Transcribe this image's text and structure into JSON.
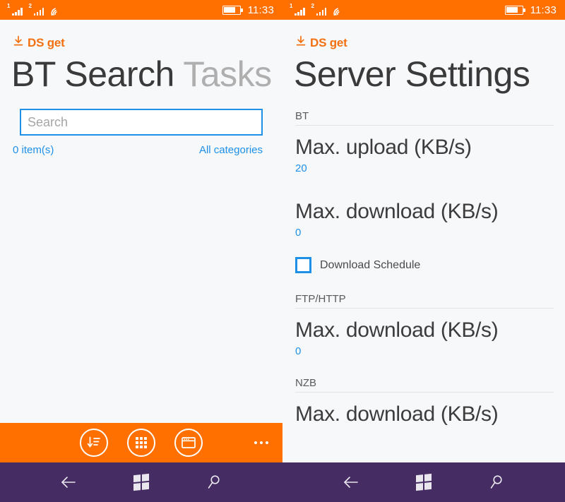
{
  "theme": {
    "accent_orange": "#FF7000",
    "accent_blue": "#1E90E8",
    "nav_purple": "#452C63",
    "page_background": "#F7F8FA",
    "title_color": "#3A3A3A",
    "inactive_title_color": "#AFAFAF"
  },
  "status_bar": {
    "signal_1_label": "1",
    "signal_2_label": "2",
    "wifi_icon": "wifi-icon",
    "battery_icon": "battery-icon",
    "clock": "11:33"
  },
  "left_panel": {
    "app_logo": {
      "icon": "download-icon",
      "name": "DS get"
    },
    "title_active": "BT Search",
    "title_inactive": "Tasks",
    "search": {
      "value": "",
      "placeholder": "Search"
    },
    "item_count": "0 item(s)",
    "category_filter": "All categories",
    "appbar": {
      "buttons": [
        {
          "icon": "sort-download-icon",
          "label": "Sort"
        },
        {
          "icon": "grid-apps-icon",
          "label": "Categories"
        },
        {
          "icon": "window-icon",
          "label": "Window"
        }
      ],
      "more_label": "..."
    }
  },
  "right_panel": {
    "app_logo": {
      "icon": "download-icon",
      "name": "DS get"
    },
    "title": "Server Settings",
    "sections": [
      {
        "header": "BT",
        "settings": [
          {
            "label": "Max. upload (KB/s)",
            "value": "20"
          },
          {
            "label": "Max. download (KB/s)",
            "value": "0"
          }
        ],
        "checkbox": {
          "label": "Download Schedule",
          "checked": false
        }
      },
      {
        "header": "FTP/HTTP",
        "settings": [
          {
            "label": "Max. download (KB/s)",
            "value": "0"
          }
        ]
      },
      {
        "header": "NZB",
        "settings": [
          {
            "label": "Max. download (KB/s)",
            "value": ""
          }
        ]
      }
    ]
  },
  "nav_bar": {
    "back_label": "Back",
    "start_label": "Start",
    "search_label": "Search"
  }
}
